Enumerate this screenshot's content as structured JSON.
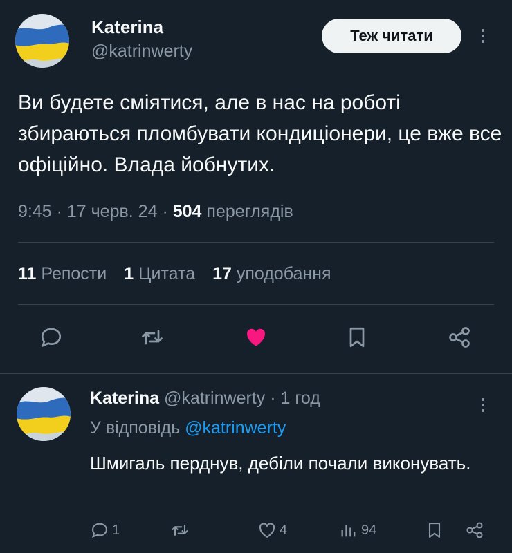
{
  "colors": {
    "background": "#15202b",
    "text": "#f7f9f9",
    "muted": "#8b98a5",
    "accent": "#1d9bf0",
    "like": "#f91880",
    "divider": "#38444d"
  },
  "main": {
    "author_name": "Katerina",
    "author_handle": "@katrinwerty",
    "follow_label": "Теж читати",
    "text": "Ви будете сміятися, але в нас на роботі збираються пломбувати кондиціонери, це вже все офіційно. Влада йобнутих.",
    "time": "9:45",
    "date": "17 черв. 24",
    "views_count": "504",
    "views_label": "переглядів",
    "reposts_count": "11",
    "reposts_label": "Репости",
    "quotes_count": "1",
    "quotes_label": "Цитата",
    "likes_count": "17",
    "likes_label": "уподобання",
    "icons": [
      "reply-icon",
      "retweet-icon",
      "heart-filled-icon",
      "bookmark-icon",
      "share-icon"
    ]
  },
  "reply": {
    "author_name": "Katerina",
    "author_handle": "@katrinwerty",
    "age": "1 год",
    "replying_prefix": "У відповідь",
    "replying_to": "@katrinwerty",
    "text": "Шмигаль перднув, дебіли почали виконувать.",
    "reply_count": "1",
    "retweet_count": "",
    "like_count": "4",
    "views_count": "94",
    "icons": [
      "reply-icon",
      "retweet-icon",
      "heart-icon",
      "views-icon",
      "bookmark-icon",
      "share-icon"
    ]
  }
}
